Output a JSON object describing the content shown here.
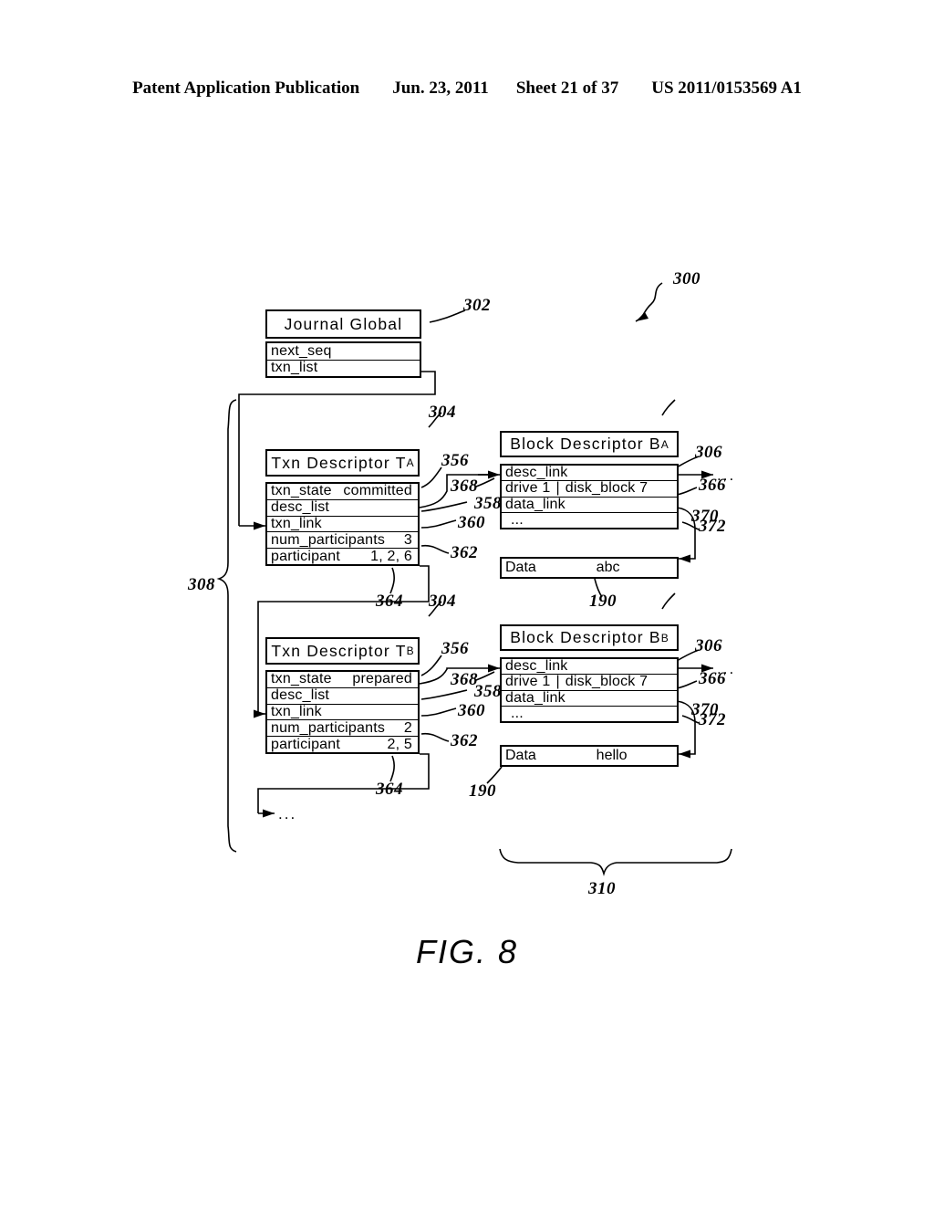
{
  "header": {
    "publication": "Patent Application Publication",
    "date": "Jun. 23, 2011",
    "sheet": "Sheet 21 of 37",
    "docnum": "US 2011/0153569 A1"
  },
  "figure": {
    "label": "FIG. 8",
    "overall_ref": "300"
  },
  "journal_global": {
    "ref": "302",
    "title": "Journal Global",
    "fields": [
      "next_seq",
      "txn_list"
    ]
  },
  "txn_a": {
    "ref": "304",
    "title": "Txn Descriptor T",
    "subscript": "A",
    "rows": [
      {
        "name": "txn_state",
        "value": "committed",
        "ref": "356"
      },
      {
        "name": "desc_list",
        "value": "",
        "ref": "358"
      },
      {
        "name": "txn_link",
        "value": "",
        "ref": "360"
      },
      {
        "name": "num_participants",
        "value": "3",
        "ref": "362"
      },
      {
        "name": "participant",
        "value": "1, 2, 6",
        "ref": "364"
      }
    ]
  },
  "txn_b": {
    "ref": "304",
    "title": "Txn Descriptor T",
    "subscript": "B",
    "rows": [
      {
        "name": "txn_state",
        "value": "prepared",
        "ref": "356"
      },
      {
        "name": "desc_list",
        "value": "",
        "ref": "358"
      },
      {
        "name": "txn_link",
        "value": "",
        "ref": "360"
      },
      {
        "name": "num_participants",
        "value": "2",
        "ref": "362"
      },
      {
        "name": "participant",
        "value": "2, 5",
        "ref": "364"
      }
    ]
  },
  "block_a": {
    "ref": "306",
    "title": "Block Descriptor B",
    "subscript": "A",
    "rows": [
      {
        "name": "desc_link",
        "value": "",
        "ref": "366"
      },
      {
        "name": "drive 1",
        "sep": "|",
        "value": "disk_block 7",
        "ref": "370"
      },
      {
        "name": "data_link",
        "value": "",
        "ref": "372"
      },
      {
        "name": "...",
        "value": ""
      }
    ],
    "data": {
      "label": "Data",
      "value": "abc",
      "ref": "190"
    },
    "tail": "..."
  },
  "block_b": {
    "ref": "306",
    "title": "Block Descriptor B",
    "subscript": "B",
    "rows": [
      {
        "name": "desc_link",
        "value": "",
        "ref": "366"
      },
      {
        "name": "drive 1",
        "sep": "|",
        "value": "disk_block 7",
        "ref": "370"
      },
      {
        "name": "data_link",
        "value": "",
        "ref": "372"
      },
      {
        "name": "...",
        "value": ""
      }
    ],
    "data": {
      "label": "Data",
      "value": "hello",
      "ref": "190"
    },
    "tail": "..."
  },
  "brackets": {
    "txn_list_ref": "308",
    "block_list_ref": "310"
  },
  "misc": {
    "ellipsis": "...",
    "link_368": "368"
  }
}
